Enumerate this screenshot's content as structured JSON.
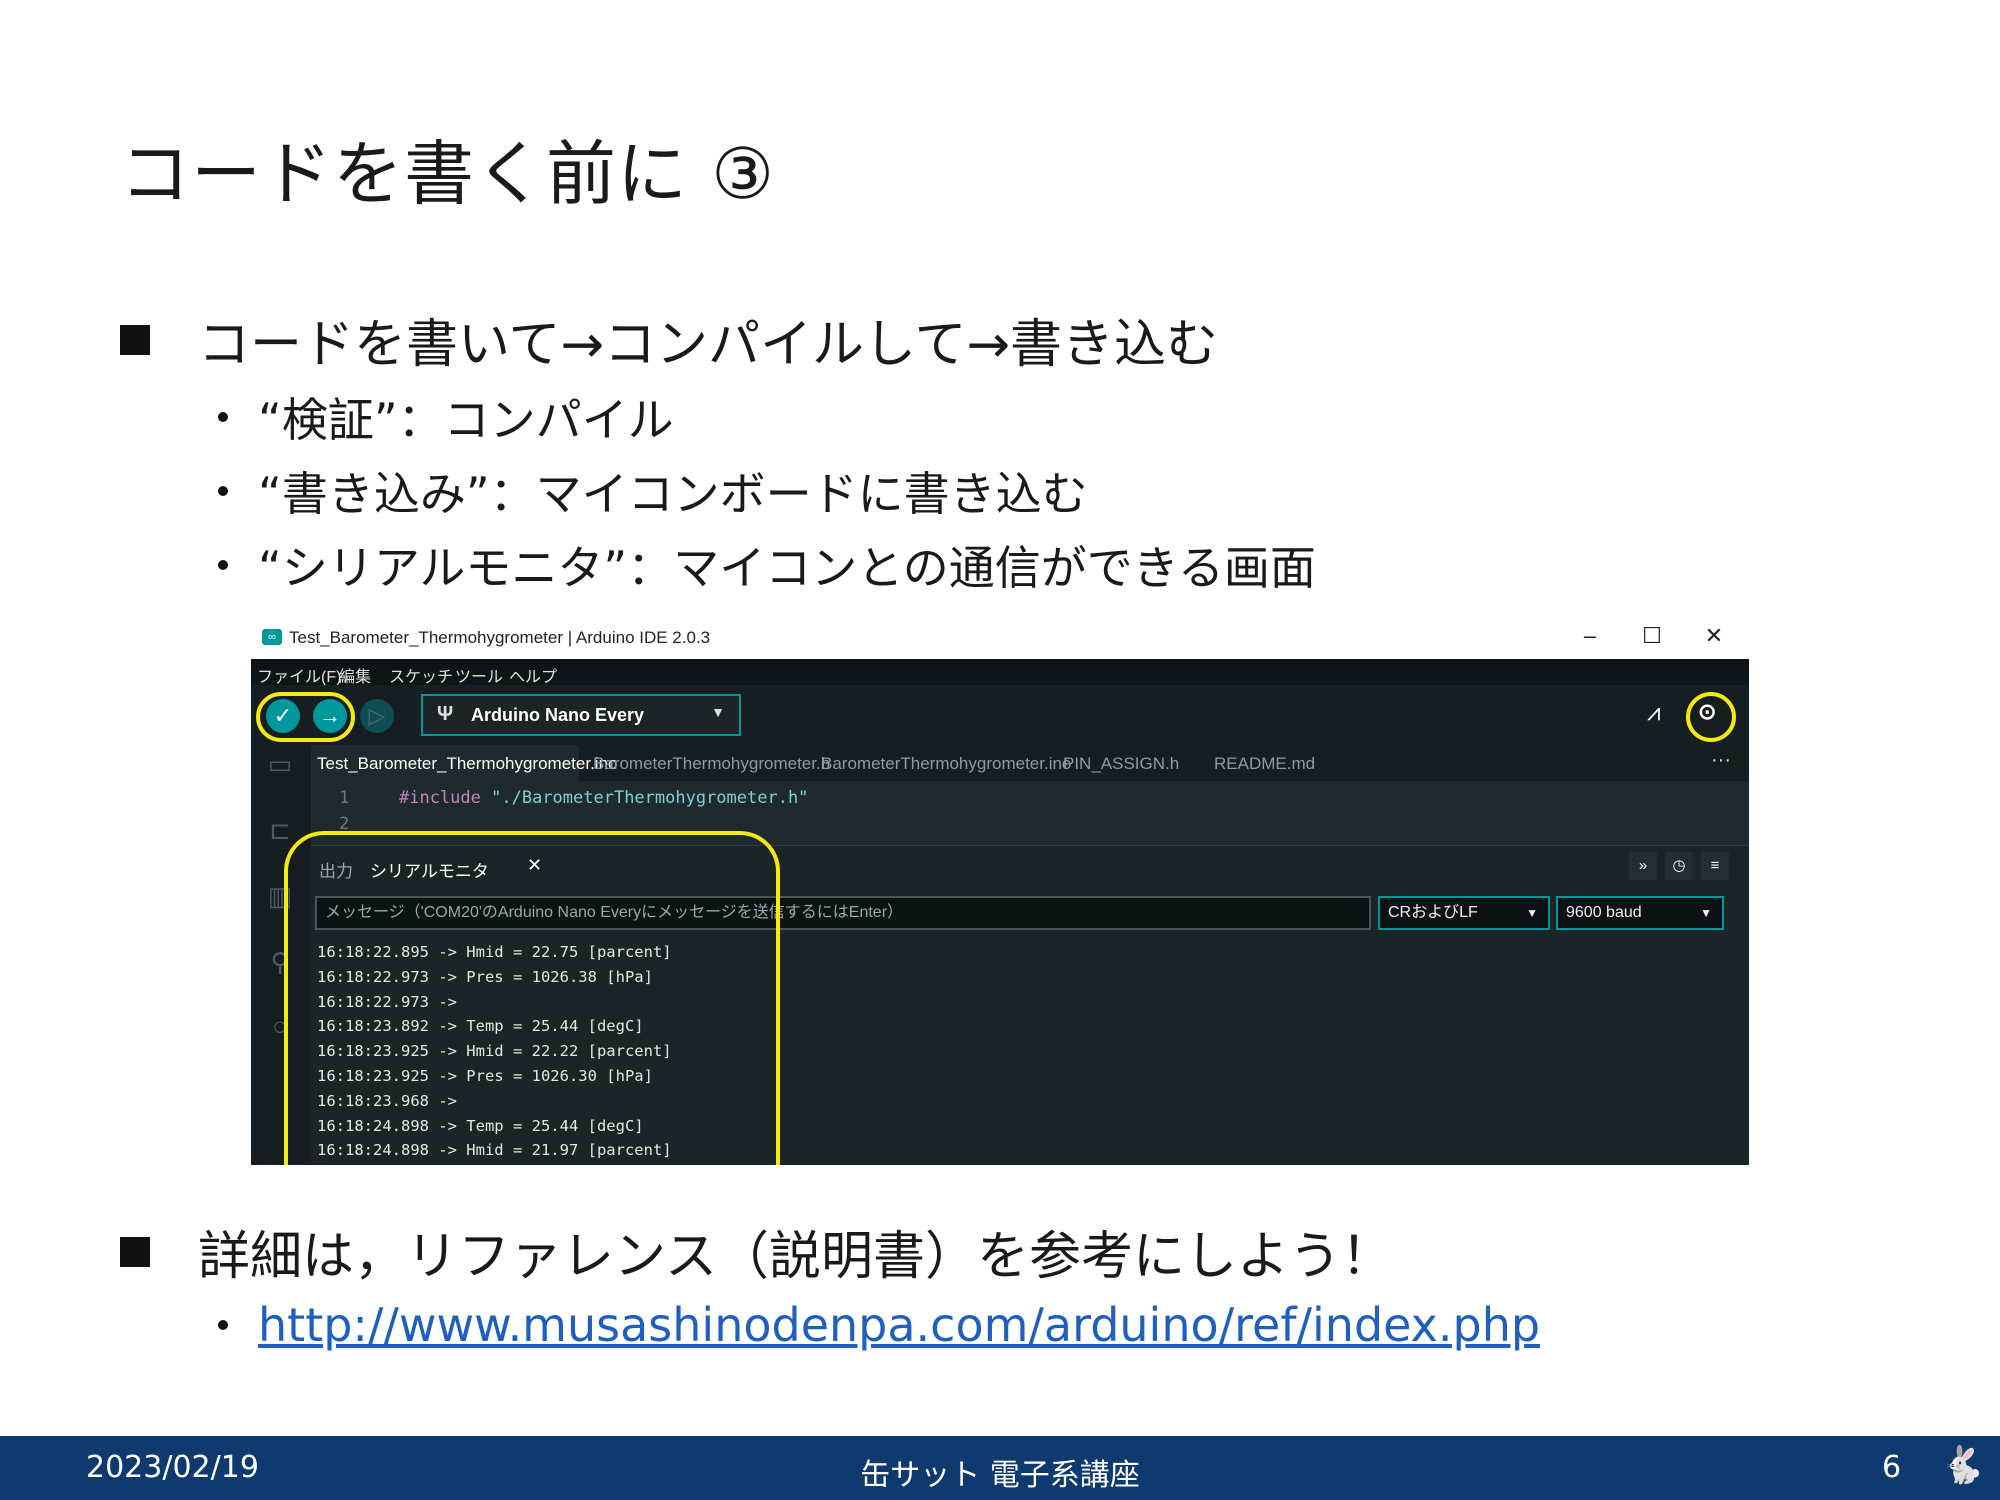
{
  "slide": {
    "title": "コードを書く前に ③",
    "bullet1": "コードを書いて→コンパイルして→書き込む",
    "sub1": "“検証”：コンパイル",
    "sub2": "“書き込み”：マイコンボードに書き込む",
    "sub3": "“シリアルモニタ”：マイコンとの通信ができる画面",
    "bullet2": "詳細は，リファレンス（説明書）を参考にしよう！",
    "link": "http://www.musashinodenpa.com/arduino/ref/index.php"
  },
  "ide": {
    "window_title": "Test_Barometer_Thermohygrometer | Arduino IDE 2.0.3",
    "menu": [
      "ファイル(F)",
      "編集",
      "スケッチ",
      "ツール",
      "ヘルプ"
    ],
    "board": "Arduino Nano Every",
    "tabs": [
      "Test_Barometer_Thermohygrometer.ino",
      "BarometerThermohygrometer.h",
      "BarometerThermohygrometer.ino",
      "PIN_ASSIGN.h",
      "README.md"
    ],
    "code_line_1_no": "1",
    "code_line_2_no": "2",
    "code_include_kw": "#include",
    "code_include_str": "\"./BarometerThermohygrometer.h\"",
    "panel_tab_output": "出力",
    "panel_tab_serial": "シリアルモニタ",
    "message_placeholder": "メッセージ（'COM20'のArduino Nano Everyにメッセージを送信するにはEnter）",
    "line_ending": "CRおよびLF",
    "baud": "9600 baud",
    "serial_lines": [
      "16:18:22.895 -> Hmid = 22.75 [parcent]",
      "16:18:22.973 -> Pres = 1026.38 [hPa]",
      "16:18:22.973 ->",
      "16:18:23.892 -> Temp = 25.44 [degC]",
      "16:18:23.925 -> Hmid = 22.22 [parcent]",
      "16:18:23.925 -> Pres = 1026.30 [hPa]",
      "16:18:23.968 ->",
      "16:18:24.898 -> Temp = 25.44 [degC]",
      "16:18:24.898 -> Hmid = 21.97 [parcent]"
    ]
  },
  "footer": {
    "date": "2023/02/19",
    "center": "缶サット 電子系講座",
    "page": "6"
  },
  "colors": {
    "arduino_teal": "#00979d",
    "highlight_yellow": "#f3ea12",
    "footer_blue": "#0f3a70",
    "link_blue": "#1f5fbf"
  }
}
